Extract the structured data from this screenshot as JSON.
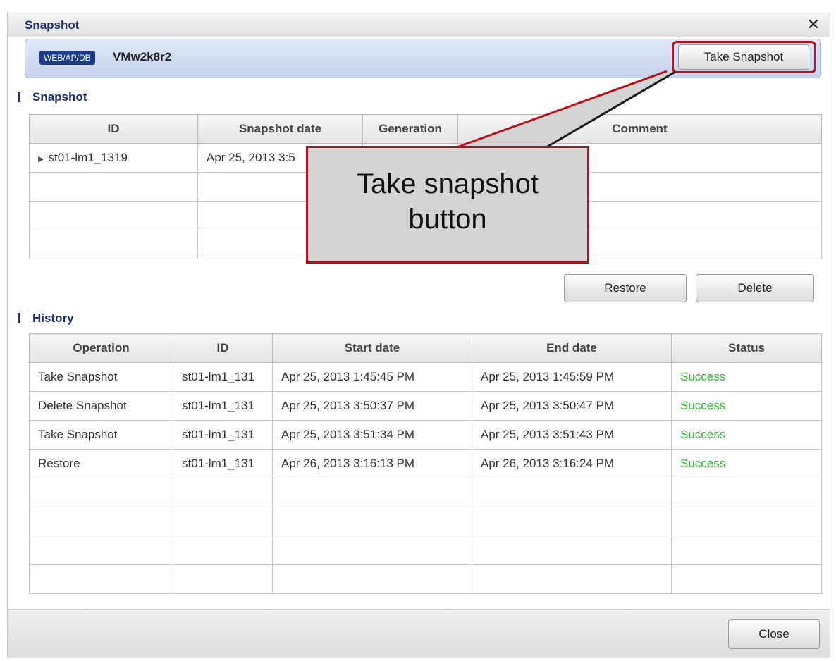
{
  "dialog": {
    "title": "Snapshot",
    "close_icon": "close-icon"
  },
  "header": {
    "type_badge": "WEB/AP/DB",
    "vm_name": "VMw2k8r2",
    "take_snapshot_label": "Take Snapshot"
  },
  "snapshot_section": {
    "label": "Snapshot",
    "columns": [
      "ID",
      "Snapshot date",
      "Generation",
      "Comment"
    ],
    "rows": [
      {
        "id": "st01-lm1_1319",
        "date": "Apr 25, 2013 3:5",
        "generation": "",
        "comment": ""
      }
    ],
    "restore_label": "Restore",
    "delete_label": "Delete"
  },
  "history_section": {
    "label": "History",
    "columns": [
      "Operation",
      "ID",
      "Start date",
      "End date",
      "Status"
    ],
    "rows": [
      {
        "operation": "Take Snapshot",
        "id": "st01-lm1_131",
        "start": "Apr 25, 2013 1:45:45 PM",
        "end": "Apr 25, 2013 1:45:59 PM",
        "status": "Success"
      },
      {
        "operation": "Delete Snapshot",
        "id": "st01-lm1_131",
        "start": "Apr 25, 2013 3:50:37 PM",
        "end": "Apr 25, 2013 3:50:47 PM",
        "status": "Success"
      },
      {
        "operation": "Take Snapshot",
        "id": "st01-lm1_131",
        "start": "Apr 25, 2013 3:51:34 PM",
        "end": "Apr 25, 2013 3:51:43 PM",
        "status": "Success"
      },
      {
        "operation": "Restore",
        "id": "st01-lm1_131",
        "start": "Apr 26, 2013 3:16:13 PM",
        "end": "Apr 26, 2013 3:16:24 PM",
        "status": "Success"
      }
    ]
  },
  "footer": {
    "close_label": "Close"
  },
  "callout": {
    "line1": "Take snapshot",
    "line2": "button"
  },
  "colors": {
    "title": "#1b2f6b",
    "highlight": "#b5121b",
    "success": "#2fb52f",
    "callout_bg": "#d4d4d4"
  }
}
